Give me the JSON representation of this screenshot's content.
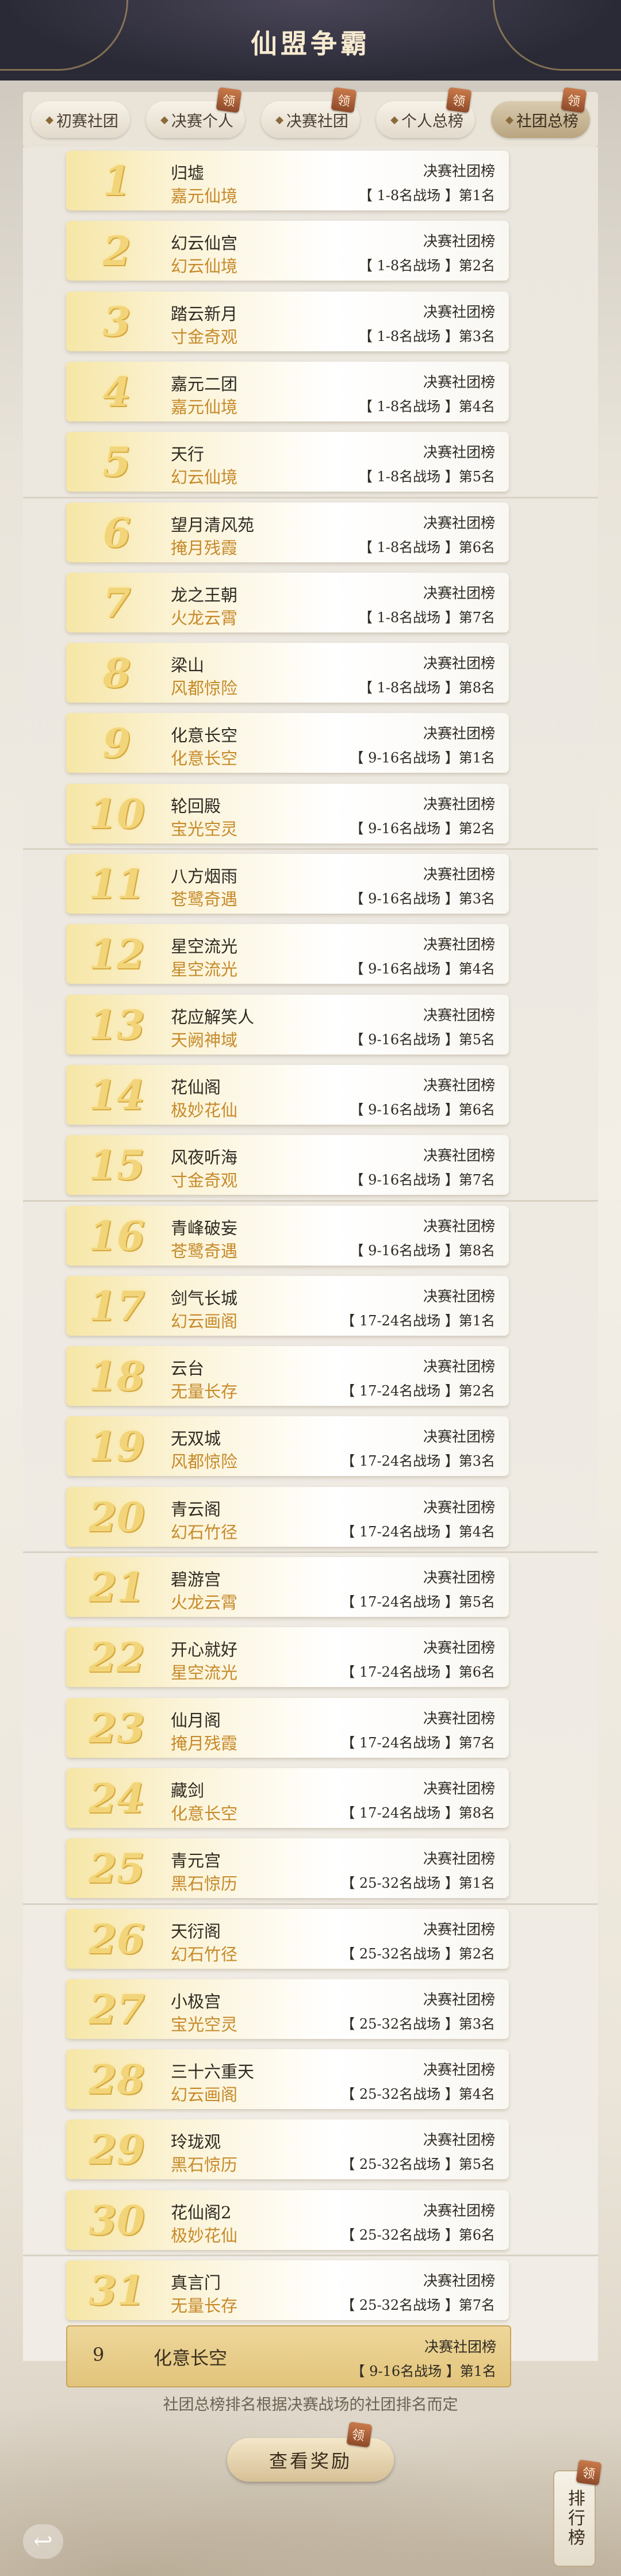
{
  "title": "仙盟争霸",
  "tabs": [
    {
      "label": "初赛社团",
      "badge": ""
    },
    {
      "label": "决赛个人",
      "badge": "领"
    },
    {
      "label": "决赛社团",
      "badge": "领"
    },
    {
      "label": "个人总榜",
      "badge": "领"
    },
    {
      "label": "社团总榜",
      "badge": "领",
      "active": true
    }
  ],
  "rows": [
    {
      "rank": "1",
      "club": "归墟",
      "server": "嘉元仙境",
      "category": "决赛社团榜",
      "place": "【 1-8名战场 】第1名"
    },
    {
      "rank": "2",
      "club": "幻云仙宫",
      "server": "幻云仙境",
      "category": "决赛社团榜",
      "place": "【 1-8名战场 】第2名"
    },
    {
      "rank": "3",
      "club": "踏云新月",
      "server": "寸金奇观",
      "category": "决赛社团榜",
      "place": "【 1-8名战场 】第3名"
    },
    {
      "rank": "4",
      "club": "嘉元二团",
      "server": "嘉元仙境",
      "category": "决赛社团榜",
      "place": "【 1-8名战场 】第4名"
    },
    {
      "rank": "5",
      "club": "天行",
      "server": "幻云仙境",
      "category": "决赛社团榜",
      "place": "【 1-8名战场 】第5名"
    },
    {
      "rank": "6",
      "club": "望月清风苑",
      "server": "掩月残霞",
      "category": "决赛社团榜",
      "place": "【 1-8名战场 】第6名"
    },
    {
      "rank": "7",
      "club": "龙之王朝",
      "server": "火龙云霄",
      "category": "决赛社团榜",
      "place": "【 1-8名战场 】第7名"
    },
    {
      "rank": "8",
      "club": "梁山",
      "server": "风都惊险",
      "category": "决赛社团榜",
      "place": "【 1-8名战场 】第8名"
    },
    {
      "rank": "9",
      "club": "化意长空",
      "server": "化意长空",
      "category": "决赛社团榜",
      "place": "【 9-16名战场 】第1名"
    },
    {
      "rank": "10",
      "club": "轮回殿",
      "server": "宝光空灵",
      "category": "决赛社团榜",
      "place": "【 9-16名战场 】第2名"
    },
    {
      "rank": "11",
      "club": "八方烟雨",
      "server": "苍鹭奇遇",
      "category": "决赛社团榜",
      "place": "【 9-16名战场 】第3名"
    },
    {
      "rank": "12",
      "club": "星空流光",
      "server": "星空流光",
      "category": "决赛社团榜",
      "place": "【 9-16名战场 】第4名"
    },
    {
      "rank": "13",
      "club": "花应解笑人",
      "server": "天阙神域",
      "category": "决赛社团榜",
      "place": "【 9-16名战场 】第5名"
    },
    {
      "rank": "14",
      "club": "花仙阁",
      "server": "极妙花仙",
      "category": "决赛社团榜",
      "place": "【 9-16名战场 】第6名"
    },
    {
      "rank": "15",
      "club": "风夜听海",
      "server": "寸金奇观",
      "category": "决赛社团榜",
      "place": "【 9-16名战场 】第7名"
    },
    {
      "rank": "16",
      "club": "青峰破妄",
      "server": "苍鹭奇遇",
      "category": "决赛社团榜",
      "place": "【 9-16名战场 】第8名"
    },
    {
      "rank": "17",
      "club": "剑气长城",
      "server": "幻云画阁",
      "category": "决赛社团榜",
      "place": "【 17-24名战场 】第1名"
    },
    {
      "rank": "18",
      "club": "云台",
      "server": "无量长存",
      "category": "决赛社团榜",
      "place": "【 17-24名战场 】第2名"
    },
    {
      "rank": "19",
      "club": "无双城",
      "server": "风都惊险",
      "category": "决赛社团榜",
      "place": "【 17-24名战场 】第3名"
    },
    {
      "rank": "20",
      "club": "青云阁",
      "server": "幻石竹径",
      "category": "决赛社团榜",
      "place": "【 17-24名战场 】第4名"
    },
    {
      "rank": "21",
      "club": "碧游宫",
      "server": "火龙云霄",
      "category": "决赛社团榜",
      "place": "【 17-24名战场 】第5名"
    },
    {
      "rank": "22",
      "club": "开心就好",
      "server": "星空流光",
      "category": "决赛社团榜",
      "place": "【 17-24名战场 】第6名"
    },
    {
      "rank": "23",
      "club": "仙月阁",
      "server": "掩月残霞",
      "category": "决赛社团榜",
      "place": "【 17-24名战场 】第7名"
    },
    {
      "rank": "24",
      "club": "藏剑",
      "server": "化意长空",
      "category": "决赛社团榜",
      "place": "【 17-24名战场 】第8名"
    },
    {
      "rank": "25",
      "club": "青元宫",
      "server": "黑石惊历",
      "category": "决赛社团榜",
      "place": "【 25-32名战场 】第1名"
    },
    {
      "rank": "26",
      "club": "天衍阁",
      "server": "幻石竹径",
      "category": "决赛社团榜",
      "place": "【 25-32名战场 】第2名"
    },
    {
      "rank": "27",
      "club": "小极宫",
      "server": "宝光空灵",
      "category": "决赛社团榜",
      "place": "【 25-32名战场 】第3名"
    },
    {
      "rank": "28",
      "club": "三十六重天",
      "server": "幻云画阁",
      "category": "决赛社团榜",
      "place": "【 25-32名战场 】第4名"
    },
    {
      "rank": "29",
      "club": "玲珑观",
      "server": "黑石惊历",
      "category": "决赛社团榜",
      "place": "【 25-32名战场 】第5名"
    },
    {
      "rank": "30",
      "club": "花仙阁2",
      "server": "极妙花仙",
      "category": "决赛社团榜",
      "place": "【 25-32名战场 】第6名"
    },
    {
      "rank": "31",
      "club": "真言门",
      "server": "无量长存",
      "category": "决赛社团榜",
      "place": "【 25-32名战场 】第7名"
    }
  ],
  "my_row": {
    "rank": "9",
    "club": "化意长空",
    "category": "决赛社团榜",
    "place": "【 9-16名战场 】第1名"
  },
  "note": "社团总榜排名根据决赛战场的社团排名而定",
  "reward_button": "查看奖励",
  "reward_badge": "领",
  "rank_button": "排行榜",
  "rank_badge": "领",
  "back_icon": "↩"
}
